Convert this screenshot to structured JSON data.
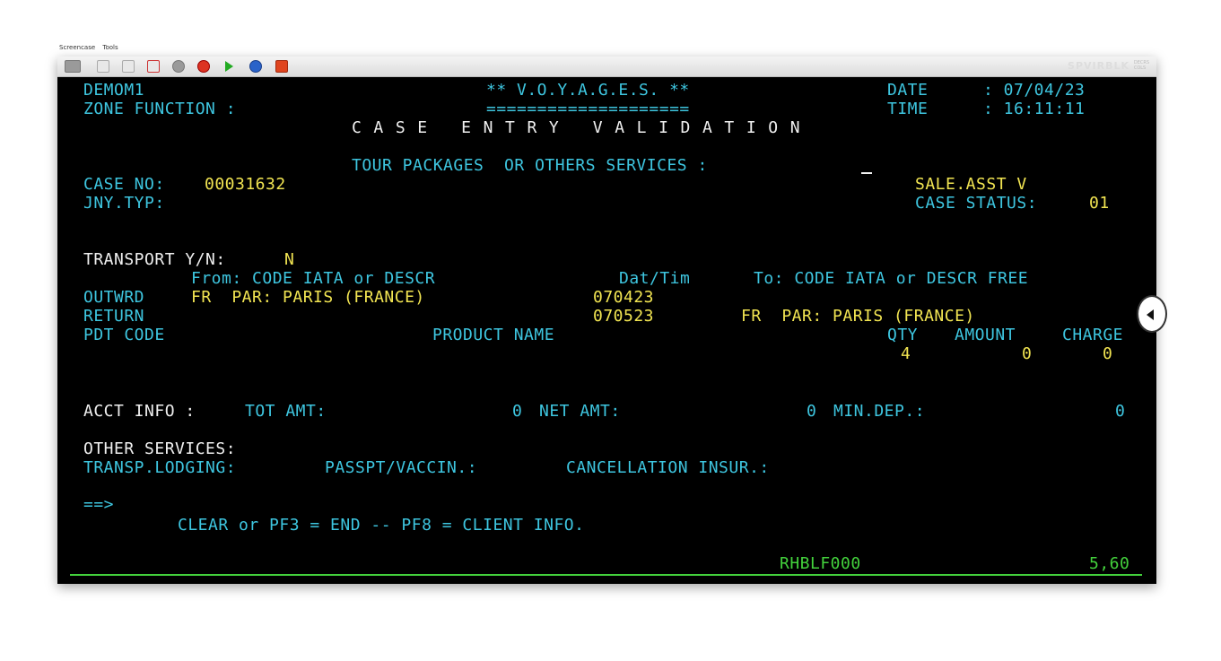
{
  "menubar": {
    "items": [
      "Screencase",
      "Tools"
    ]
  },
  "toolbar": {
    "session": "SPVIRBLK",
    "session_sub1": "DECRS",
    "session_sub2": "COLS",
    "icons": [
      "keyboard-icon",
      "page-icon",
      "print-icon",
      "mail-icon",
      "settings-icon",
      "record-icon",
      "play-icon",
      "help-icon",
      "stop-icon"
    ]
  },
  "screen": {
    "user": "DEMOM1",
    "app_title": "** V.O.Y.A.G.E.S. **",
    "app_underline": "====================",
    "date_label": "DATE",
    "date_value": ": 07/04/23",
    "zone_label": "ZONE FUNCTION :",
    "time_label": "TIME",
    "time_value": ": 16:11:11",
    "title": "CASE ENTRY VALIDATION",
    "tour_label": "TOUR PACKAGES  OR OTHERS SERVICES :",
    "case_no_label": "CASE NO:",
    "case_no_value": "00031632",
    "sale_asst": "SALE.ASST V",
    "jny_typ_label": "JNY.TYP:",
    "case_status_label": "CASE STATUS:",
    "case_status_value": "01",
    "transport_label": "TRANSPORT Y/N:",
    "transport_value": "N",
    "from_header": "From: CODE IATA or DESCR",
    "dattim_header": "Dat/Tim",
    "to_header": "To: CODE IATA or DESCR FREE",
    "outwrd_label": "OUTWRD",
    "outwrd_from": "FR  PAR: PARIS (FRANCE)",
    "outwrd_date": "070423",
    "return_label": "RETURN",
    "return_date": "070523",
    "return_to": "FR  PAR: PARIS (FRANCE)",
    "pdt_code_header": "PDT CODE",
    "product_name_header": "PRODUCT NAME",
    "qty_header": "QTY",
    "amount_header": "AMOUNT",
    "charge_header": "CHARGE",
    "qty_value": "4",
    "amount_value": "0",
    "charge_value": "0",
    "acct_info_label": "ACCT INFO :",
    "tot_amt_label": "TOT AMT:",
    "tot_amt_value": "0",
    "net_amt_label": "NET AMT:",
    "net_amt_value": "0",
    "min_dep_label": "MIN.DEP.:",
    "min_dep_value": "0",
    "other_services_label": "OTHER SERVICES:",
    "transp_lodging_label": "TRANSP.LODGING:",
    "passpt_label": "PASSPT/VACCIN.:",
    "cancellation_label": "CANCELLATION INSUR.:",
    "command_prompt": "==>",
    "pf_help": "CLEAR or PF3 = END -- PF8 = CLIENT INFO.",
    "status_screen_id": "RHBLF000",
    "status_cursor_pos": "5,60"
  }
}
